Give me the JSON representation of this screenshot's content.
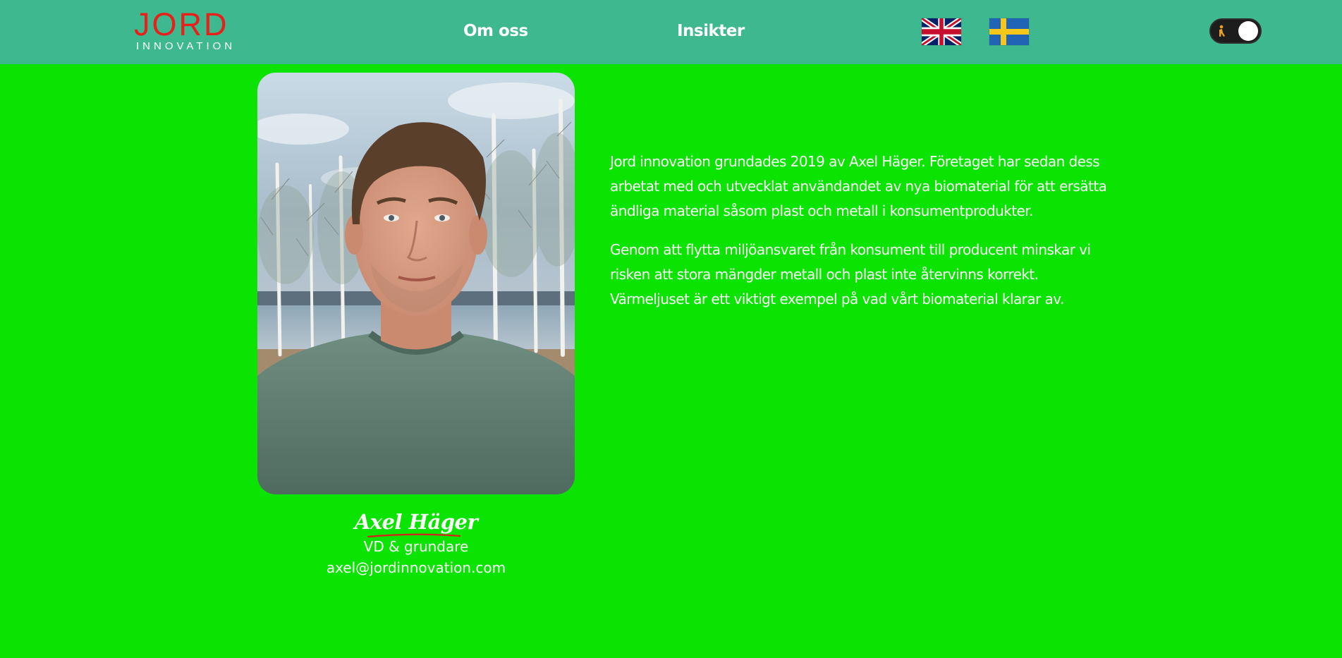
{
  "header": {
    "logo": {
      "main": "JORD",
      "sub": "INNOVATION"
    },
    "nav": [
      {
        "label": "Om oss"
      },
      {
        "label": "Insikter"
      }
    ],
    "languages": [
      {
        "icon": "uk-flag-icon"
      },
      {
        "icon": "sweden-flag-icon"
      }
    ],
    "theme_toggle": {
      "icon": "person-icon",
      "state": "on"
    }
  },
  "profile": {
    "name": "Axel Häger",
    "role": "VD & grundare",
    "email": "axel@jordinnovation.com"
  },
  "about": {
    "paragraphs": [
      "Jord innovation grundades 2019 av Axel Häger. Företaget har sedan dess arbetat med och utvecklat användandet av nya biomaterial för att ersätta ändliga material såsom plast och metall i konsumentprodukter.",
      "Genom att flytta miljöansvaret från konsument till producent minskar vi risken att stora mängder metall och plast inte återvinns korrekt. Värmeljuset är ett viktigt exempel på vad vårt biomaterial klarar av."
    ]
  },
  "colors": {
    "page_background": "#0ae400",
    "header_background": "#3db88f",
    "logo_red": "#ea1f19",
    "text": "#ffffff"
  }
}
